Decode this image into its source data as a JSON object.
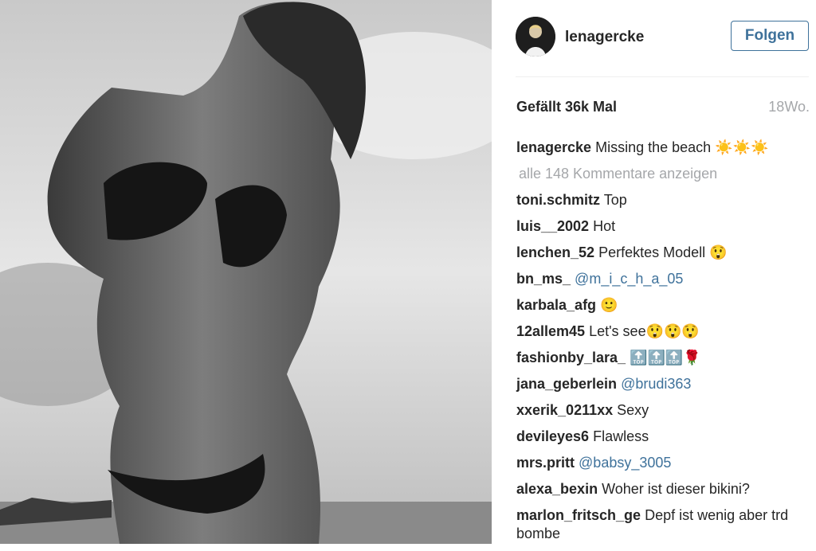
{
  "post": {
    "username": "lenagercke",
    "follow_label": "Folgen",
    "likes": "Gefällt 36k Mal",
    "age": "18Wo.",
    "caption_user": "lenagercke",
    "caption_text": "Missing the beach ☀️☀️☀️",
    "show_all_comments": "alle 148 Kommentare anzeigen"
  },
  "comments": [
    {
      "user": "toni.schmitz",
      "text": "Top"
    },
    {
      "user": "luis__2002",
      "text": "Hot"
    },
    {
      "user": "lenchen_52",
      "text": "Perfektes Modell 😲"
    },
    {
      "user": "bn_ms_",
      "mention": "@m_i_c_h_a_05"
    },
    {
      "user": "karbala_afg",
      "text": "🙂"
    },
    {
      "user": "12allem45",
      "text": "Let's see😲😲😲"
    },
    {
      "user": "fashionby_lara_",
      "text": "🔝🔝🔝🌹"
    },
    {
      "user": "jana_geberlein",
      "mention": "@brudi363"
    },
    {
      "user": "xxerik_0211xx",
      "text": "Sexy"
    },
    {
      "user": "devileyes6",
      "text": "Flawless"
    },
    {
      "user": "mrs.pritt",
      "mention": "@babsy_3005"
    },
    {
      "user": "alexa_bexin",
      "text": "Woher ist dieser bikini?"
    },
    {
      "user": "marlon_fritsch_ge",
      "text": "Depf ist wenig aber trd bombe"
    }
  ],
  "colors": {
    "link": "#3f729b",
    "muted": "#a5a7aa",
    "text": "#262626"
  }
}
